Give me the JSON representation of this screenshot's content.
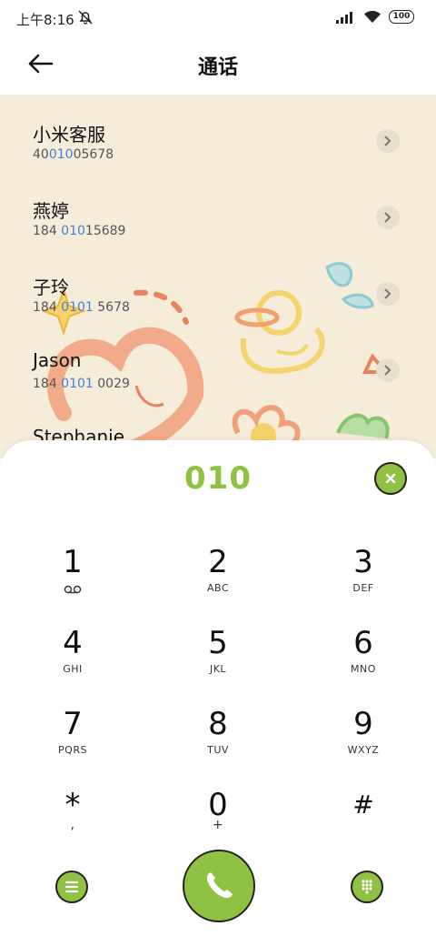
{
  "status_bar": {
    "time": "上午8:16",
    "battery": "100"
  },
  "header": {
    "title": "通话"
  },
  "contacts": [
    {
      "name": "小米客服",
      "num_pre": "40",
      "num_hl": "010",
      "num_post": "05678"
    },
    {
      "name": "燕婷",
      "num_pre": "184 ",
      "num_hl": "010",
      "num_post": "15689"
    },
    {
      "name": "子玲",
      "num_pre": "184 ",
      "num_hl": "0101",
      "num_post": " 5678"
    },
    {
      "name": "Jason",
      "num_pre": "184 ",
      "num_hl": "0101",
      "num_post": " 0029"
    },
    {
      "name": "Stephanie",
      "num_pre": "",
      "num_hl": "",
      "num_post": ""
    }
  ],
  "dialer": {
    "number": "010",
    "keys": [
      {
        "digit": "1",
        "letters": ""
      },
      {
        "digit": "2",
        "letters": "ABC"
      },
      {
        "digit": "3",
        "letters": "DEF"
      },
      {
        "digit": "4",
        "letters": "GHI"
      },
      {
        "digit": "5",
        "letters": "JKL"
      },
      {
        "digit": "6",
        "letters": "MNO"
      },
      {
        "digit": "7",
        "letters": "PQRS"
      },
      {
        "digit": "8",
        "letters": "TUV"
      },
      {
        "digit": "9",
        "letters": "WXYZ"
      },
      {
        "digit": "*",
        "letters": ","
      },
      {
        "digit": "0",
        "letters": "+"
      },
      {
        "digit": "#",
        "letters": ""
      }
    ]
  },
  "colors": {
    "accent": "#8fc242",
    "highlight": "#4a7fd8",
    "list_bg": "#f5ecd9"
  }
}
